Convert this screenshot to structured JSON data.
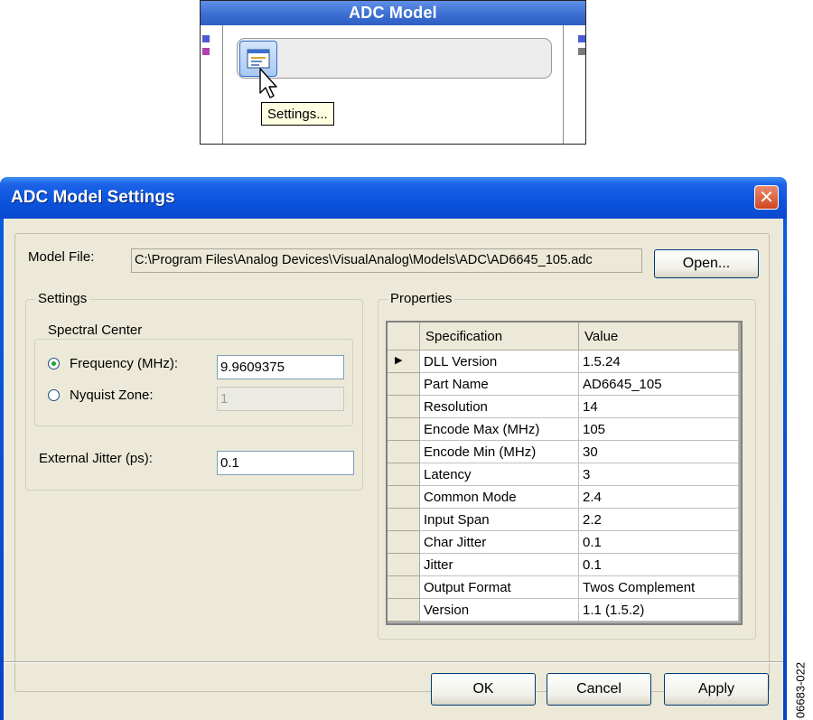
{
  "block": {
    "title": "ADC Model",
    "tooltip": "Settings..."
  },
  "dialog": {
    "title": "ADC Model Settings",
    "model_file_label": "Model File:",
    "model_file_value": "C:\\Program Files\\Analog Devices\\VisualAnalog\\Models\\ADC\\AD6645_105.adc",
    "open_button": "Open...",
    "settings_group": "Settings",
    "spectral_center_group": "Spectral Center",
    "frequency_label": "Frequency (MHz):",
    "frequency_value": "9.9609375",
    "frequency_selected": true,
    "nyquist_label": "Nyquist Zone:",
    "nyquist_value": "1",
    "jitter_label": "External Jitter (ps):",
    "jitter_value": "0.1",
    "properties_group": "Properties",
    "table": {
      "columns": [
        "Specification",
        "Value"
      ],
      "rows": [
        {
          "spec": "DLL Version",
          "value": "1.5.24"
        },
        {
          "spec": "Part Name",
          "value": "AD6645_105"
        },
        {
          "spec": "Resolution",
          "value": "14"
        },
        {
          "spec": "Encode Max (MHz)",
          "value": "105"
        },
        {
          "spec": "Encode Min (MHz)",
          "value": "30"
        },
        {
          "spec": "Latency",
          "value": "3"
        },
        {
          "spec": "Common Mode",
          "value": "2.4"
        },
        {
          "spec": "Input Span",
          "value": "2.2"
        },
        {
          "spec": "Char Jitter",
          "value": "0.1"
        },
        {
          "spec": "Jitter",
          "value": "0.1"
        },
        {
          "spec": "Output Format",
          "value": "Twos Complement"
        },
        {
          "spec": "Version",
          "value": "1.1 (1.5.2)"
        }
      ],
      "current_row": 0
    },
    "ok_button": "OK",
    "cancel_button": "Cancel",
    "apply_button": "Apply"
  },
  "figure_id": "06683-022",
  "colors": {
    "title_blue": "#0b53dc",
    "dialog_face": "#ece9d8",
    "block_header": "#3c6fd3"
  }
}
